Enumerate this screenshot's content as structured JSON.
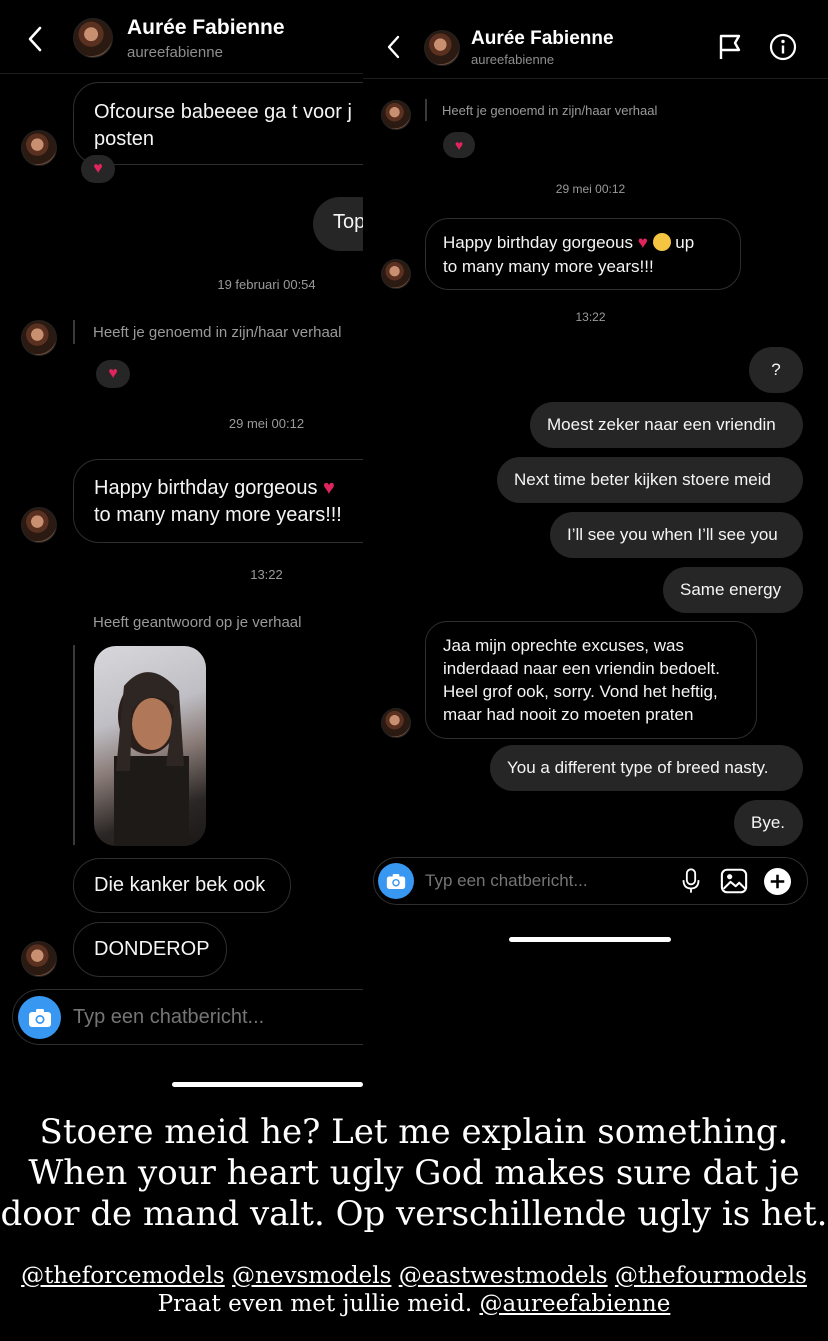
{
  "left": {
    "header": {
      "name": "Aurée Fabienne",
      "handle": "aureefabienne"
    },
    "messages": {
      "m1": "Ofcourse babeeee ga t voor j posten",
      "m2_partial": "Top",
      "ts1": "19 februari 00:54",
      "mention_story": "Heeft je genoemd in zijn/haar verhaal",
      "ts2": "29 mei 00:12",
      "bday": "Happy birthday gorgeous",
      "bday2": "to many many more years!!!",
      "ts3": "13:22",
      "story_reply": "Heeft geantwoord op je verhaal",
      "m3": "Die kanker bek ook",
      "m4": "DONDEROP"
    },
    "compose": {
      "placeholder": "Typ een chatbericht..."
    }
  },
  "right": {
    "header": {
      "name": "Aurée Fabienne",
      "handle": "aureefabienne"
    },
    "messages": {
      "mention_story": "Heeft je genoemd in zijn/haar verhaal",
      "ts1": "29 mei 00:12",
      "bday": "Happy birthday gorgeous",
      "bday_up": "up",
      "bday2": "to many many more years!!!",
      "ts2": "13:22",
      "q": "?",
      "s1": "Moest zeker naar een vriendin",
      "s2": "Next time beter kijken stoere meid",
      "s3": "I’ll see you when I’ll see you",
      "s4": "Same energy",
      "r1_l1": "Jaa mijn oprechte excuses, was",
      "r1_l2": "inderdaad naar een vriendin bedoelt.",
      "r1_l3": "Heel grof ook, sorry. Vond het heftig,",
      "r1_l4": "maar had nooit zo moeten praten",
      "s5": "You a different type of breed nasty.",
      "s6": "Bye."
    },
    "compose": {
      "placeholder": "Typ een chatbericht..."
    }
  },
  "caption": {
    "line1": "Stoere meid he? Let me explain something.",
    "line2": "When your heart ugly God makes sure dat je",
    "line3": "door de mand valt. Op verschillende ugly is het.",
    "mentions": [
      "@theforcemodels",
      "@nevsmodels",
      "@eastwestmodels",
      "@thefourmodels"
    ],
    "line5_text": "Praat even met jullie meid.",
    "line5_mention": "@aureefabienne"
  }
}
